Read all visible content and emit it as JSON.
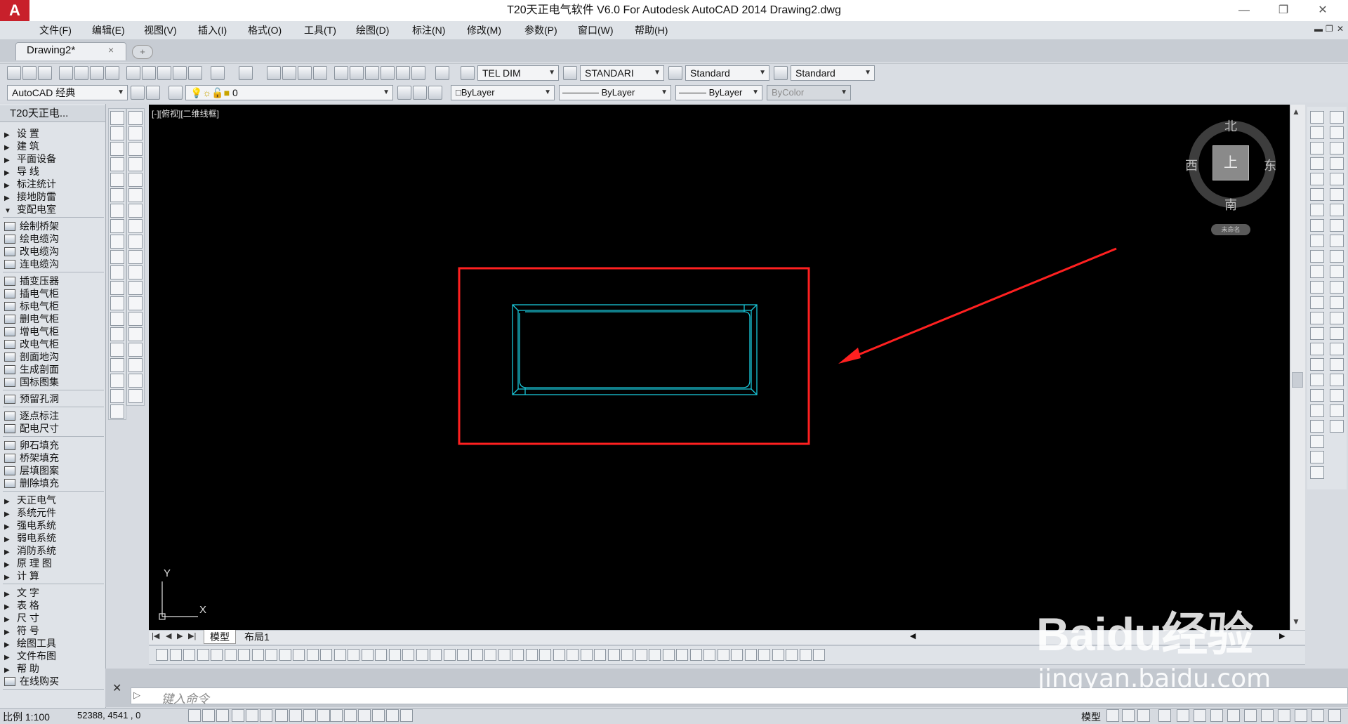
{
  "window": {
    "title": "T20天正电气软件 V6.0 For Autodesk AutoCAD 2014    Drawing2.dwg",
    "logo": "A",
    "minimize": "—",
    "restore": "❐",
    "close": "✕"
  },
  "menu": [
    "文件(F)",
    "编辑(E)",
    "视图(V)",
    "插入(I)",
    "格式(O)",
    "工具(T)",
    "绘图(D)",
    "标注(N)",
    "修改(M)",
    "参数(P)",
    "窗口(W)",
    "帮助(H)"
  ],
  "tabs": {
    "active": "Drawing2*",
    "close": "×",
    "new": "+"
  },
  "toolbar": {
    "dim_style": "TEL DIM",
    "text_style": "STANDARI",
    "table_style": "Standard",
    "multileader_style": "Standard",
    "workspace": "AutoCAD 经典",
    "layer": "0",
    "color": "ByLayer",
    "linetype": "ByLayer",
    "lineweight": "ByLayer",
    "plotstyle": "ByColor"
  },
  "panel": {
    "title": "T20天正电...",
    "groups": [
      [
        {
          "label": "设    置",
          "kind": "arrow"
        },
        {
          "label": "建    筑",
          "kind": "arrow"
        },
        {
          "label": "平面设备",
          "kind": "arrow"
        },
        {
          "label": "导    线",
          "kind": "arrow"
        },
        {
          "label": "标注统计",
          "kind": "arrow"
        },
        {
          "label": "接地防雷",
          "kind": "arrow"
        },
        {
          "label": "变配电室",
          "kind": "open"
        }
      ],
      [
        {
          "label": "绘制桥架",
          "kind": "icon"
        },
        {
          "label": "绘电缆沟",
          "kind": "icon"
        },
        {
          "label": "改电缆沟",
          "kind": "icon"
        },
        {
          "label": "连电缆沟",
          "kind": "icon"
        }
      ],
      [
        {
          "label": "插变压器",
          "kind": "icon"
        },
        {
          "label": "插电气柜",
          "kind": "icon"
        },
        {
          "label": "标电气柜",
          "kind": "icon"
        },
        {
          "label": "删电气柜",
          "kind": "icon"
        },
        {
          "label": "增电气柜",
          "kind": "icon"
        },
        {
          "label": "改电气柜",
          "kind": "icon"
        },
        {
          "label": "剖面地沟",
          "kind": "icon"
        },
        {
          "label": "生成剖面",
          "kind": "icon"
        },
        {
          "label": "国标图集",
          "kind": "icon"
        }
      ],
      [
        {
          "label": "预留孔洞",
          "kind": "icon"
        }
      ],
      [
        {
          "label": "逐点标注",
          "kind": "icon"
        },
        {
          "label": "配电尺寸",
          "kind": "icon"
        }
      ],
      [
        {
          "label": "卵石填充",
          "kind": "icon"
        },
        {
          "label": "桥架填充",
          "kind": "icon"
        },
        {
          "label": "层填图案",
          "kind": "icon"
        },
        {
          "label": "删除填充",
          "kind": "icon"
        }
      ],
      [
        {
          "label": "天正电气",
          "kind": "arrow"
        },
        {
          "label": "系统元件",
          "kind": "arrow"
        },
        {
          "label": "强电系统",
          "kind": "arrow"
        },
        {
          "label": "弱电系统",
          "kind": "arrow"
        },
        {
          "label": "消防系统",
          "kind": "arrow"
        },
        {
          "label": "原 理 图",
          "kind": "arrow"
        },
        {
          "label": "计    算",
          "kind": "arrow"
        }
      ],
      [
        {
          "label": "文    字",
          "kind": "arrow"
        },
        {
          "label": "表    格",
          "kind": "arrow"
        },
        {
          "label": "尺    寸",
          "kind": "arrow"
        },
        {
          "label": "符    号",
          "kind": "arrow"
        },
        {
          "label": "绘图工具",
          "kind": "arrow"
        },
        {
          "label": "文件布图",
          "kind": "arrow"
        },
        {
          "label": "帮    助",
          "kind": "arrow"
        },
        {
          "label": "在线购买",
          "kind": "icon"
        }
      ]
    ]
  },
  "viewport": {
    "label": "[-][俯视][二维线框]"
  },
  "compass": {
    "north": "北",
    "south": "南",
    "east": "东",
    "west": "西",
    "cube": "上",
    "wcs": "未命名"
  },
  "ucs": {
    "x": "X",
    "y": "Y"
  },
  "layout_tabs": {
    "model": "模型",
    "layout1": "布局1"
  },
  "command": {
    "placeholder": "键入命令",
    "prompt_icon": "▷"
  },
  "status": {
    "scale": "比例 1:100",
    "coords": "52388,  4541  ,  0",
    "model": "模型"
  },
  "colors": {
    "annotation": "#ff2020",
    "geometry": "#19c6d8",
    "canvas": "#000000"
  },
  "watermark": {
    "logo": "Baidu经验",
    "url": "jingyan.baidu.com"
  }
}
